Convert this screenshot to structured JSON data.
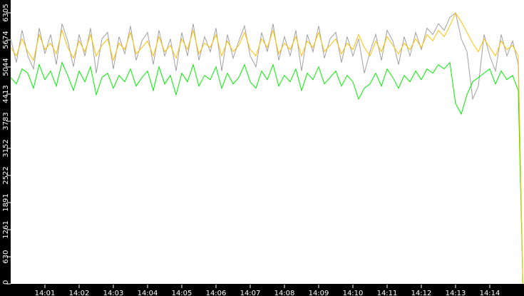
{
  "chart_data": {
    "type": "line",
    "title": "",
    "xlabel": "",
    "ylabel": "",
    "ylim": [
      0,
      6603
    ],
    "xlim_minutes": [
      0,
      15
    ],
    "x_start": "14:00:00",
    "x_step_seconds": 10,
    "x_ticks": [
      "14:01",
      "14:02",
      "14:03",
      "14:04",
      "14:05",
      "14:06",
      "14:07",
      "14:08",
      "14:09",
      "14:10",
      "14:11",
      "14:12",
      "14:13",
      "14:14"
    ],
    "y_ticks": [
      0,
      630,
      1261,
      1891,
      2522,
      3152,
      3783,
      4413,
      5044,
      5674,
      6305
    ],
    "grid": false,
    "legend": "none",
    "series": [
      {
        "name": "gray",
        "color": "#a0a0a0",
        "values": [
          5700,
          5150,
          5900,
          5300,
          5000,
          5950,
          5350,
          5800,
          5100,
          6050,
          5650,
          5050,
          5800,
          5300,
          5950,
          4900,
          5700,
          5850,
          5000,
          5750,
          5350,
          6000,
          5200,
          5650,
          5850,
          5100,
          5900,
          5300,
          5700,
          4950,
          5850,
          5300,
          6050,
          5200,
          5750,
          5400,
          5950,
          4950,
          5800,
          5250,
          5650,
          6000,
          5300,
          5050,
          5850,
          5400,
          6050,
          5200,
          5750,
          5300,
          5900,
          4950,
          5800,
          5400,
          6000,
          5250,
          5700,
          5850,
          5150,
          5750,
          5300,
          5700,
          4900,
          5400,
          5800,
          5200,
          5900,
          5650,
          5100,
          5750,
          5300,
          5850,
          5450,
          5950,
          5800,
          6050,
          5900,
          6200,
          6305,
          5700,
          5400,
          4300,
          4600,
          5800,
          5300,
          4950,
          5800,
          5300,
          5650,
          5100,
          0
        ]
      },
      {
        "name": "green",
        "color": "#00ee00",
        "values": [
          4800,
          4650,
          5000,
          4900,
          4550,
          5100,
          4750,
          4950,
          4600,
          5150,
          4850,
          4500,
          4950,
          4700,
          5050,
          4400,
          4800,
          4900,
          4550,
          4850,
          4700,
          5000,
          4600,
          4800,
          4950,
          4500,
          5050,
          4650,
          4850,
          4400,
          4900,
          4700,
          5100,
          4600,
          4850,
          4750,
          5050,
          4550,
          4900,
          4650,
          4800,
          5100,
          4700,
          4550,
          4950,
          4750,
          5100,
          4600,
          4850,
          4700,
          5000,
          4500,
          4900,
          4750,
          5050,
          4650,
          4800,
          4950,
          4600,
          4850,
          4700,
          4300,
          4550,
          4650,
          4900,
          4600,
          5000,
          4800,
          4550,
          4850,
          4700,
          4950,
          4750,
          5000,
          4900,
          5100,
          5000,
          5150,
          4200,
          3950,
          4400,
          4700,
          4800,
          4900,
          5000,
          4650,
          4950,
          4750,
          4850,
          4500,
          0
        ]
      },
      {
        "name": "yellow",
        "color": "#ffc000",
        "values": [
          5500,
          5300,
          5700,
          5400,
          5200,
          5800,
          5450,
          5600,
          5350,
          5900,
          5500,
          5250,
          5650,
          5400,
          5800,
          5300,
          5550,
          5700,
          5200,
          5600,
          5450,
          5850,
          5350,
          5500,
          5650,
          5300,
          5750,
          5400,
          5550,
          5250,
          5700,
          5450,
          5900,
          5350,
          5600,
          5500,
          5800,
          5300,
          5650,
          5400,
          5550,
          5850,
          5450,
          5300,
          5700,
          5500,
          5900,
          5350,
          5600,
          5450,
          5750,
          5300,
          5650,
          5500,
          5850,
          5400,
          5550,
          5700,
          5350,
          5600,
          5450,
          5800,
          5500,
          5300,
          5650,
          5400,
          5750,
          5550,
          5350,
          5600,
          5450,
          5700,
          5500,
          5800,
          5650,
          5900,
          5750,
          6000,
          6300,
          6100,
          5850,
          5600,
          5400,
          5700,
          5500,
          5300,
          5650,
          5450,
          5550,
          5300,
          0
        ]
      }
    ]
  }
}
